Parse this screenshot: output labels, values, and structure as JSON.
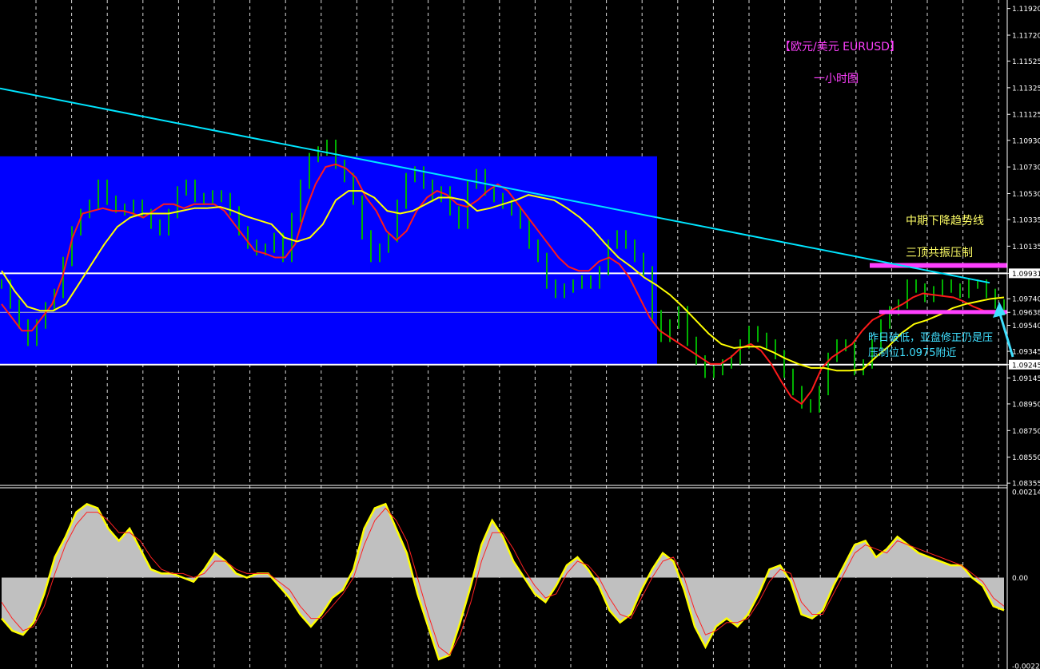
{
  "chart_data": [
    {
      "type": "line",
      "panel": "price",
      "title": "【欧元/美元 EURUSD】",
      "subtitle": "一小时图",
      "ylim": [
        1.0835,
        1.1196
      ],
      "yticks": [
        "1.11920",
        "1.11720",
        "1.11525",
        "1.11325",
        "1.11125",
        "1.10930",
        "1.10730",
        "1.10530",
        "1.10335",
        "1.10135",
        "1.09931",
        "1.09740",
        "1.09638",
        "1.09540",
        "1.09345",
        "1.09245",
        "1.09145",
        "1.08950",
        "1.08750",
        "1.08550",
        "1.08355"
      ],
      "horizontal_levels": [
        {
          "value": 1.09931,
          "color": "#ffffff",
          "label": "1.09931"
        },
        {
          "value": 1.09638,
          "color": "#c0c0c0",
          "label": "1.09638"
        },
        {
          "value": 1.09245,
          "color": "#ffffff",
          "label": "1.09245"
        }
      ],
      "range_box": {
        "from": 1.09245,
        "to": 1.1081,
        "color": "#0000ff"
      },
      "trendline": {
        "from": 1.1132,
        "to": 1.0986,
        "color": "#00e5ff"
      },
      "resistance_band": {
        "value": 1.0999,
        "color": "#ff40ff"
      },
      "support_band": {
        "value": 1.0964,
        "color": "#ff40ff"
      },
      "series": [
        {
          "name": "Close",
          "color": "#00b000",
          "values": [
            1.0985,
            1.097,
            1.0955,
            1.0942,
            1.0955,
            1.0968,
            1.0978,
            1.1002,
            1.1025,
            1.1038,
            1.1045,
            1.106,
            1.1048,
            1.1042,
            1.104,
            1.1045,
            1.1038,
            1.103,
            1.1025,
            1.1038,
            1.1055,
            1.106,
            1.105,
            1.1048,
            1.1052,
            1.105,
            1.104,
            1.1025,
            1.1015,
            1.101,
            1.1012,
            1.102,
            1.1005,
            1.1035,
            1.106,
            1.108,
            1.1085,
            1.109,
            1.1075,
            1.1065,
            1.1048,
            1.1022,
            1.1005,
            1.1012,
            1.102,
            1.1045,
            1.1065,
            1.107,
            1.106,
            1.105,
            1.1055,
            1.104,
            1.103,
            1.106,
            1.1068,
            1.1055,
            1.105,
            1.1045,
            1.104,
            1.103,
            1.1015,
            1.1005,
            1.0985,
            1.0978,
            1.0982,
            1.0985,
            1.0988,
            1.0985,
            1.0995,
            1.1015,
            1.1022,
            1.1015,
            1.1005,
            1.0995,
            1.0962,
            1.0945,
            1.0955,
            1.0965,
            1.0942,
            1.0928,
            1.0918,
            1.092,
            1.0925,
            1.0928,
            1.094,
            1.095,
            1.0945,
            1.094,
            1.0932,
            1.0918,
            1.0905,
            1.0895,
            1.0892,
            1.0905,
            1.093,
            1.094,
            1.0938,
            1.092,
            1.0925,
            1.094,
            1.0955,
            1.0965,
            1.097,
            1.0985,
            1.0982,
            1.0975,
            1.098,
            1.0985,
            1.0982,
            1.0978,
            1.0985,
            1.0985,
            1.0978,
            1.097,
            1.0965
          ]
        },
        {
          "name": "MA-fast",
          "color": "#ff1a1a",
          "values": [
            1.097,
            1.096,
            1.095,
            1.095,
            1.096,
            1.097,
            1.099,
            1.102,
            1.1038,
            1.104,
            1.1042,
            1.104,
            1.104,
            1.1038,
            1.1035,
            1.104,
            1.1045,
            1.1045,
            1.1042,
            1.1045,
            1.1045,
            1.1045,
            1.104,
            1.103,
            1.102,
            1.101,
            1.1008,
            1.1005,
            1.1005,
            1.1015,
            1.104,
            1.106,
            1.1073,
            1.1075,
            1.1072,
            1.1065,
            1.105,
            1.104,
            1.1025,
            1.1018,
            1.1025,
            1.104,
            1.105,
            1.1055,
            1.1052,
            1.1045,
            1.1043,
            1.1048,
            1.1055,
            1.106,
            1.1055,
            1.1045,
            1.1035,
            1.1025,
            1.1015,
            1.1005,
            1.0998,
            1.0995,
            1.0995,
            1.1002,
            1.1005,
            1.1,
            1.099,
            1.0975,
            1.096,
            1.095,
            1.0945,
            1.094,
            1.0935,
            1.093,
            1.0925,
            1.0925,
            1.093,
            1.0937,
            1.094,
            1.0935,
            1.0925,
            1.0912,
            1.09,
            1.0895,
            1.0905,
            1.0922,
            1.093,
            1.0935,
            1.094,
            1.095,
            1.0958,
            1.0962,
            1.0966,
            1.097,
            1.0975,
            1.0978,
            1.0977,
            1.0976,
            1.0975,
            1.0972,
            1.0968,
            1.0965,
            1.0965,
            1.0965
          ]
        },
        {
          "name": "MA-slow",
          "color": "#ffff00",
          "values": [
            1.0995,
            1.098,
            1.0968,
            1.0965,
            1.0965,
            1.097,
            1.0985,
            1.1,
            1.1015,
            1.1028,
            1.1035,
            1.1038,
            1.1038,
            1.1038,
            1.104,
            1.1042,
            1.1042,
            1.1043,
            1.104,
            1.1036,
            1.1033,
            1.103,
            1.102,
            1.1017,
            1.102,
            1.103,
            1.1048,
            1.1055,
            1.1055,
            1.105,
            1.104,
            1.1038,
            1.104,
            1.1045,
            1.105,
            1.105,
            1.1048,
            1.104,
            1.1042,
            1.1045,
            1.1048,
            1.1052,
            1.105,
            1.1048,
            1.1042,
            1.1035,
            1.1026,
            1.1015,
            1.1005,
            1.0998,
            1.099,
            1.0984,
            1.0977,
            1.0968,
            1.0958,
            1.0948,
            1.094,
            1.0937,
            1.0938,
            1.0938,
            1.0934,
            1.0929,
            1.0925,
            1.0922,
            1.0922,
            1.092,
            1.092,
            1.0921,
            1.093,
            1.0938,
            1.0948,
            1.0955,
            1.0958,
            1.0962,
            1.0967,
            1.097,
            1.0972,
            1.0974,
            1.0975
          ]
        }
      ],
      "annotations": [
        "中期下降趋势线",
        "三顶共振压制",
        "昨日破低，亚盘修正仍是压",
        "压制位1.0975附近"
      ]
    },
    {
      "type": "area",
      "panel": "oscillator",
      "ylim": [
        -0.0022,
        0.00214
      ],
      "yticks": [
        "0.002144",
        "0.00",
        "-0.00220"
      ],
      "series": [
        {
          "name": "Histogram",
          "color": "#c0c0c0",
          "line_color": "#ffff00",
          "values": [
            -0.001,
            -0.0013,
            -0.0014,
            -0.0011,
            -0.0004,
            0.0005,
            0.001,
            0.0016,
            0.0018,
            0.0017,
            0.0012,
            0.0009,
            0.0012,
            0.0007,
            0.0002,
            0.0001,
            0.0001,
            0.0,
            -0.0001,
            0.0002,
            0.0006,
            0.0004,
            0.0001,
            0.0,
            0.0001,
            0.0001,
            -0.0002,
            -0.0005,
            -0.0009,
            -0.0012,
            -0.0009,
            -0.0005,
            -0.0003,
            0.0002,
            0.0012,
            0.0017,
            0.0018,
            0.0012,
            0.0006,
            -0.0004,
            -0.0012,
            -0.002,
            -0.0019,
            -0.0011,
            -0.0002,
            0.0008,
            0.0014,
            0.001,
            0.0004,
            0.0,
            -0.0004,
            -0.0006,
            -0.0002,
            0.0003,
            0.0005,
            0.0002,
            -0.0002,
            -0.0008,
            -0.0011,
            -0.0009,
            -0.0003,
            0.0002,
            0.0006,
            0.0004,
            -0.0003,
            -0.0012,
            -0.0017,
            -0.0012,
            -0.001,
            -0.0012,
            -0.0009,
            -0.0004,
            0.0002,
            0.0003,
            -0.0001,
            -0.0009,
            -0.001,
            -0.0008,
            -0.0002,
            0.0003,
            0.0008,
            0.0009,
            0.0005,
            0.0007,
            0.001,
            0.0008,
            0.0006,
            0.0005,
            0.0004,
            0.0003,
            0.0003,
            0.0,
            -0.0002,
            -0.0007,
            -0.0008
          ]
        },
        {
          "name": "Signal",
          "color": "#ff2020",
          "values": [
            -0.0006,
            -0.001,
            -0.0013,
            -0.0012,
            -0.0007,
            0.0001,
            0.0008,
            0.0013,
            0.0016,
            0.0016,
            0.0014,
            0.0011,
            0.0011,
            0.0009,
            0.0005,
            0.0002,
            0.0001,
            0.0001,
            0.0,
            0.0001,
            0.0004,
            0.0004,
            0.0002,
            0.0001,
            0.0001,
            0.0001,
            -0.0001,
            -0.0003,
            -0.0007,
            -0.001,
            -0.001,
            -0.0007,
            -0.0004,
            0.0,
            0.0008,
            0.0014,
            0.0017,
            0.0014,
            0.0009,
            0.0,
            -0.0009,
            -0.0017,
            -0.0019,
            -0.0014,
            -0.0006,
            0.0004,
            0.0011,
            0.0011,
            0.0007,
            0.0002,
            -0.0002,
            -0.0005,
            -0.0004,
            0.0001,
            0.0004,
            0.0003,
            0.0,
            -0.0005,
            -0.0009,
            -0.001,
            -0.0005,
            0.0,
            0.0004,
            0.0005,
            0.0,
            -0.0008,
            -0.0014,
            -0.0013,
            -0.0011,
            -0.0011,
            -0.001,
            -0.0006,
            -0.0001,
            0.0002,
            0.0001,
            -0.0006,
            -0.0009,
            -0.0009,
            -0.0004,
            0.0001,
            0.0006,
            0.0008,
            0.0007,
            0.0006,
            0.0009,
            0.0008,
            0.0007,
            0.0006,
            0.0005,
            0.0004,
            0.0003,
            0.0001,
            -0.0001,
            -0.0005,
            -0.0007
          ]
        }
      ]
    }
  ],
  "colors": {
    "background": "#000000",
    "grid": "#ffffff",
    "axis_text": "#ffffff",
    "title": "#ff40ff",
    "subtitle": "#ff40ff",
    "annotation_yellow": "#ffff66",
    "annotation_cyan": "#40e0ff",
    "arrow": "#40e0ff"
  }
}
